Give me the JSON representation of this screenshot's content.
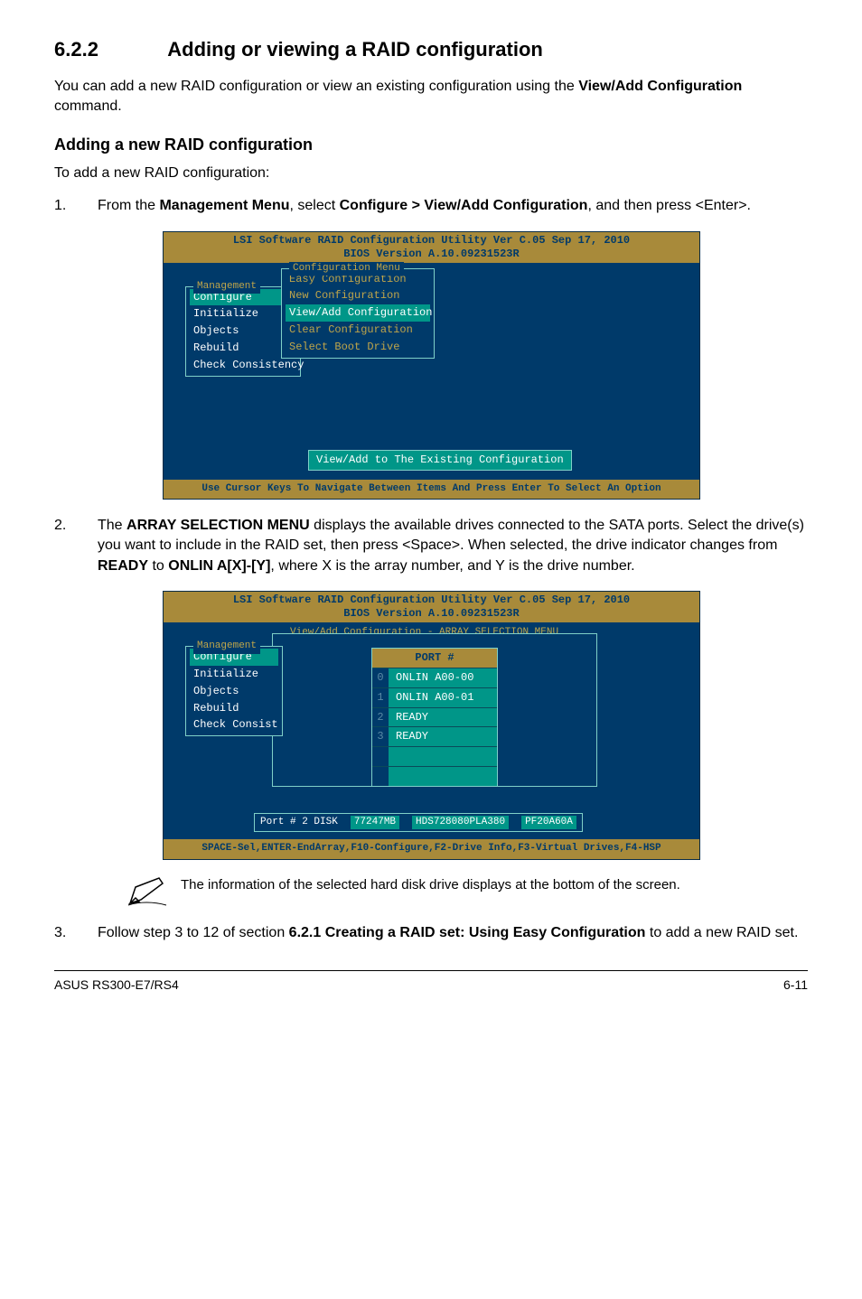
{
  "section": {
    "number": "6.2.2",
    "title": "Adding or viewing a RAID configuration"
  },
  "intro": {
    "text_a": "You can add a new RAID configuration or view an existing configuration using the ",
    "bold": "View/Add Configuration",
    "text_b": " command."
  },
  "subhead": "Adding a new RAID configuration",
  "subhead_intro": "To add a new RAID configuration:",
  "steps": [
    {
      "num": "1.",
      "pre": "From the ",
      "b1": "Management Menu",
      "mid": ", select ",
      "b2": "Configure > View/Add Configuration",
      "post": ", and then press <Enter>."
    },
    {
      "num": "2.",
      "pre": "The ",
      "b1": "ARRAY SELECTION MENU",
      "mid": " displays the available drives connected to the SATA ports. Select the drive(s) you want to include in the RAID set, then press <Space>. When selected, the drive indicator changes from ",
      "b2": "READY",
      "mid2": " to ",
      "b3": "ONLIN A[X]-[Y]",
      "post": ", where X is the array number, and Y is the drive number."
    },
    {
      "num": "3.",
      "pre": "Follow step 3 to 12 of section ",
      "b1": "6.2.1 Creating a RAID set: Using Easy Configuration",
      "post": " to add a new RAID set."
    }
  ],
  "bios": {
    "title_line1": "LSI Software RAID Configuration Utility Ver C.05 Sep 17, 2010",
    "title_line2": "BIOS Version  A.10.09231523R",
    "shot1": {
      "mgmt_legend": "Management",
      "mgmt_items": [
        "Configure",
        "Initialize",
        "Objects",
        "Rebuild",
        "Check Consistency"
      ],
      "cfg_legend": "Configuration Menu",
      "cfg_items": [
        "Easy Configuration",
        "New Configuration",
        "View/Add Configuration",
        "Clear Configuration",
        "Select Boot Drive"
      ],
      "bottom_box": "View/Add to The Existing Configuration",
      "status": "Use Cursor Keys To Navigate Between Items And Press Enter To Select An Option"
    },
    "shot2": {
      "mgmt_legend": "Management",
      "mgmt_items": [
        "Configure",
        "Initialize",
        "Objects",
        "Rebuild",
        "Check Consist"
      ],
      "array_legend": "View/Add Configuration - ARRAY SELECTION MENU",
      "port_header": "PORT #",
      "ports": [
        {
          "idx": "0",
          "val": "ONLIN A00-00"
        },
        {
          "idx": "1",
          "val": "ONLIN A00-01"
        },
        {
          "idx": "2",
          "val": "READY"
        },
        {
          "idx": "3",
          "val": "READY"
        }
      ],
      "info": {
        "port_lbl": "Port # 2 DISK",
        "size": "77247MB",
        "model": "HDS728080PLA380",
        "fw": "PF20A60A"
      },
      "status": "SPACE-Sel,ENTER-EndArray,F10-Configure,F2-Drive Info,F3-Virtual Drives,F4-HSP"
    }
  },
  "note": "The information of the selected hard disk drive displays at the bottom of the screen.",
  "footer": {
    "left": "ASUS RS300-E7/RS4",
    "right": "6-11"
  }
}
